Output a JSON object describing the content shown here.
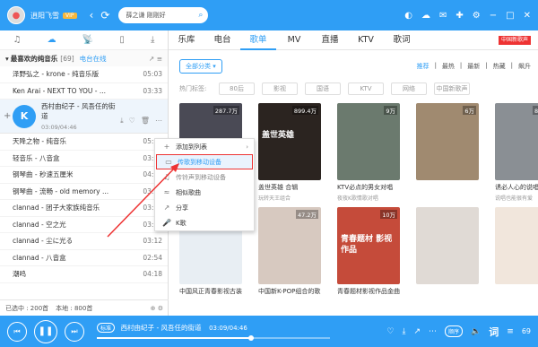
{
  "header": {
    "username": "逍阳飞雪",
    "vip": "VIP",
    "search_text": "薛之谦 刚刚好"
  },
  "tabs": [
    "乐库",
    "电台",
    "歌单",
    "MV",
    "直播",
    "KTV",
    "歌词"
  ],
  "promo": "中国新歌声",
  "playlist": {
    "title": "最喜欢的纯音乐",
    "count": "[69]",
    "online_link": "电台在线",
    "songs_before": [
      {
        "title": "泽野弘之 - krone - 纯音乐版",
        "duration": "05:03"
      },
      {
        "title": "Ken Arai - NEXT TO YOU - ...",
        "duration": "03:33"
      }
    ],
    "playing": {
      "title": "西村由纪子 - 风吾任的街道",
      "time": "03:09/04:46"
    },
    "songs_after": [
      {
        "title": "天降之物 - 纯音乐",
        "duration": "05:15"
      },
      {
        "title": "轻音乐 - 八音盒",
        "duration": "03:53"
      },
      {
        "title": "钢琴曲 - 秒速五厘米",
        "duration": "04:02"
      },
      {
        "title": "钢琴曲 - 流畅 - old memory ...",
        "duration": "03:55"
      },
      {
        "title": "clannad - 团子大家族纯音乐",
        "duration": "03:31"
      },
      {
        "title": "clannad - 空之光",
        "duration": "03:08"
      },
      {
        "title": "clannad - 尘に光る",
        "duration": "03:12"
      },
      {
        "title": "clannad - 八音盒",
        "duration": "02:54"
      },
      {
        "title": "潮鸣",
        "duration": "04:18"
      }
    ],
    "footer_selected": "已选中 : 200首",
    "footer_local": "本地 : 800首"
  },
  "filters": {
    "all_categories": "全部分类",
    "sorts": [
      "推荐",
      "最热",
      "最新",
      "热藏",
      "飙升"
    ],
    "tag_label": "热门标签:",
    "tags": [
      "80后",
      "影视",
      "国语",
      "KTV",
      "网络",
      "中国新歌声"
    ]
  },
  "cards": [
    {
      "plays": "287.7万",
      "title": "",
      "sub": "",
      "color": "#4a4a55",
      "cover_text": ""
    },
    {
      "plays": "899.4万",
      "title": "盖世英雄 合辑",
      "sub": "玩转天王组合",
      "color": "#2b2420",
      "cover_text": "盖世英雄"
    },
    {
      "plays": "9万",
      "title": "KTV必点的男女对唱",
      "sub": "夜夜K歌情歌对唱",
      "color": "#6b7a6e",
      "cover_text": ""
    },
    {
      "plays": "6万",
      "title": "",
      "sub": "",
      "color": "#a08a70",
      "cover_text": ""
    },
    {
      "plays": "86.2万",
      "title": "诱必人心的说唱情歌",
      "sub": "说唱也能很有爱",
      "color": "#8a8f94",
      "cover_text": ""
    },
    {
      "plays": "",
      "title": "中国风正青春影视古装歌曲",
      "sub": "",
      "color": "#e8eef3",
      "cover_text": ""
    },
    {
      "plays": "47.2万",
      "title": "中国新K-POP组合的歌曲",
      "sub": "",
      "color": "#d7c9c0",
      "cover_text": ""
    },
    {
      "plays": "10万",
      "title": "青春题材影视作品金曲",
      "sub": "",
      "color": "#c54b3a",
      "cover_text": "青春题材 影视作品"
    },
    {
      "plays": "",
      "title": "",
      "sub": "",
      "color": "#e0dad5",
      "cover_text": ""
    },
    {
      "plays": "",
      "title": "",
      "sub": "",
      "color": "#f1e6dc",
      "cover_text": ""
    }
  ],
  "context_menu": [
    {
      "label": "添加到列表",
      "icon": "+",
      "arrow": "›",
      "style": ""
    },
    {
      "label": "传歌到移动设备",
      "icon": "▭",
      "arrow": "",
      "style": "hl"
    },
    {
      "label": "传铃声到移动设备",
      "icon": "♫",
      "arrow": "",
      "style": "dim"
    },
    {
      "label": "相似歌曲",
      "icon": "≈",
      "arrow": "",
      "style": ""
    },
    {
      "label": "分享",
      "icon": "↗",
      "arrow": "",
      "style": ""
    },
    {
      "label": "K歌",
      "icon": "🎤",
      "arrow": "",
      "style": ""
    }
  ],
  "player": {
    "quality": "标准",
    "title": "西村由纪子 - 风吾任的街道",
    "time": "03:09/04:46",
    "progress": 0.66,
    "lyric_button": "词",
    "count": "69",
    "mode": "顺序"
  },
  "colors": {
    "brand": "#2f9ef5",
    "highlight": "#e33333"
  }
}
